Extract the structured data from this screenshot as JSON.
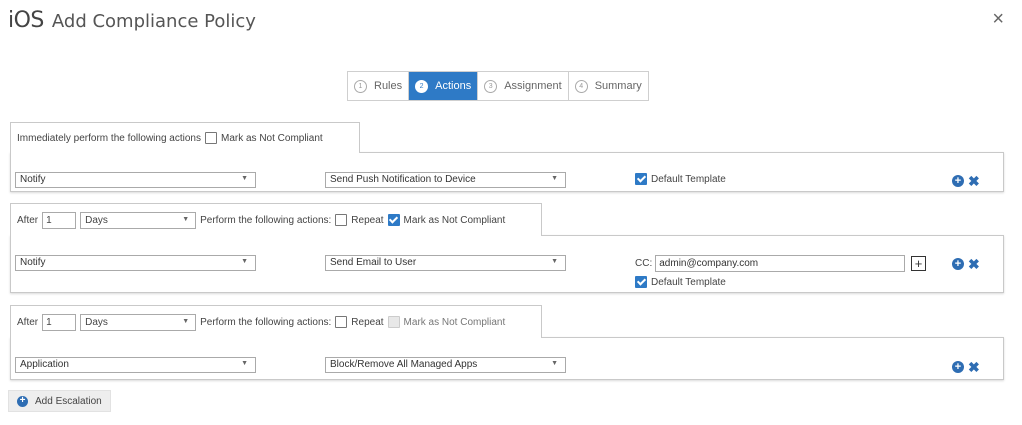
{
  "header": {
    "platform": "iOS",
    "title": "Add Compliance Policy",
    "close_icon": "×"
  },
  "steps": [
    {
      "num": "1",
      "label": "Rules",
      "active": false
    },
    {
      "num": "2",
      "label": "Actions",
      "active": true
    },
    {
      "num": "3",
      "label": "Assignment",
      "active": false
    },
    {
      "num": "4",
      "label": "Summary",
      "active": false
    }
  ],
  "block1": {
    "tab_label": "Immediately perform the following actions",
    "mark_label": "Mark as Not Compliant",
    "mark_checked": false,
    "action_type": "Notify",
    "action": "Send Push Notification to Device",
    "default_template_label": "Default Template",
    "default_template_checked": true
  },
  "block2": {
    "after_label": "After",
    "after_value": "1",
    "unit": "Days",
    "perform_label": "Perform the following actions:",
    "repeat_label": "Repeat",
    "repeat_checked": false,
    "mark_label": "Mark as Not Compliant",
    "mark_checked": true,
    "action_type": "Notify",
    "action": "Send Email to User",
    "cc_label": "CC:",
    "cc_value": "admin@company.com",
    "default_template_label": "Default Template",
    "default_template_checked": true
  },
  "block3": {
    "after_label": "After",
    "after_value": "1",
    "unit": "Days",
    "perform_label": "Perform the following actions:",
    "repeat_label": "Repeat",
    "repeat_checked": false,
    "mark_label": "Mark as Not Compliant",
    "mark_checked": false,
    "mark_disabled": true,
    "action_type": "Application",
    "action": "Block/Remove All Managed Apps"
  },
  "footer": {
    "add_escalation_label": "Add Escalation"
  },
  "icons": {
    "dropdown": "▼",
    "plus": "+",
    "remove": "✖"
  },
  "colors": {
    "accent": "#2e7ac6",
    "icon_blue": "#2e6db3"
  }
}
